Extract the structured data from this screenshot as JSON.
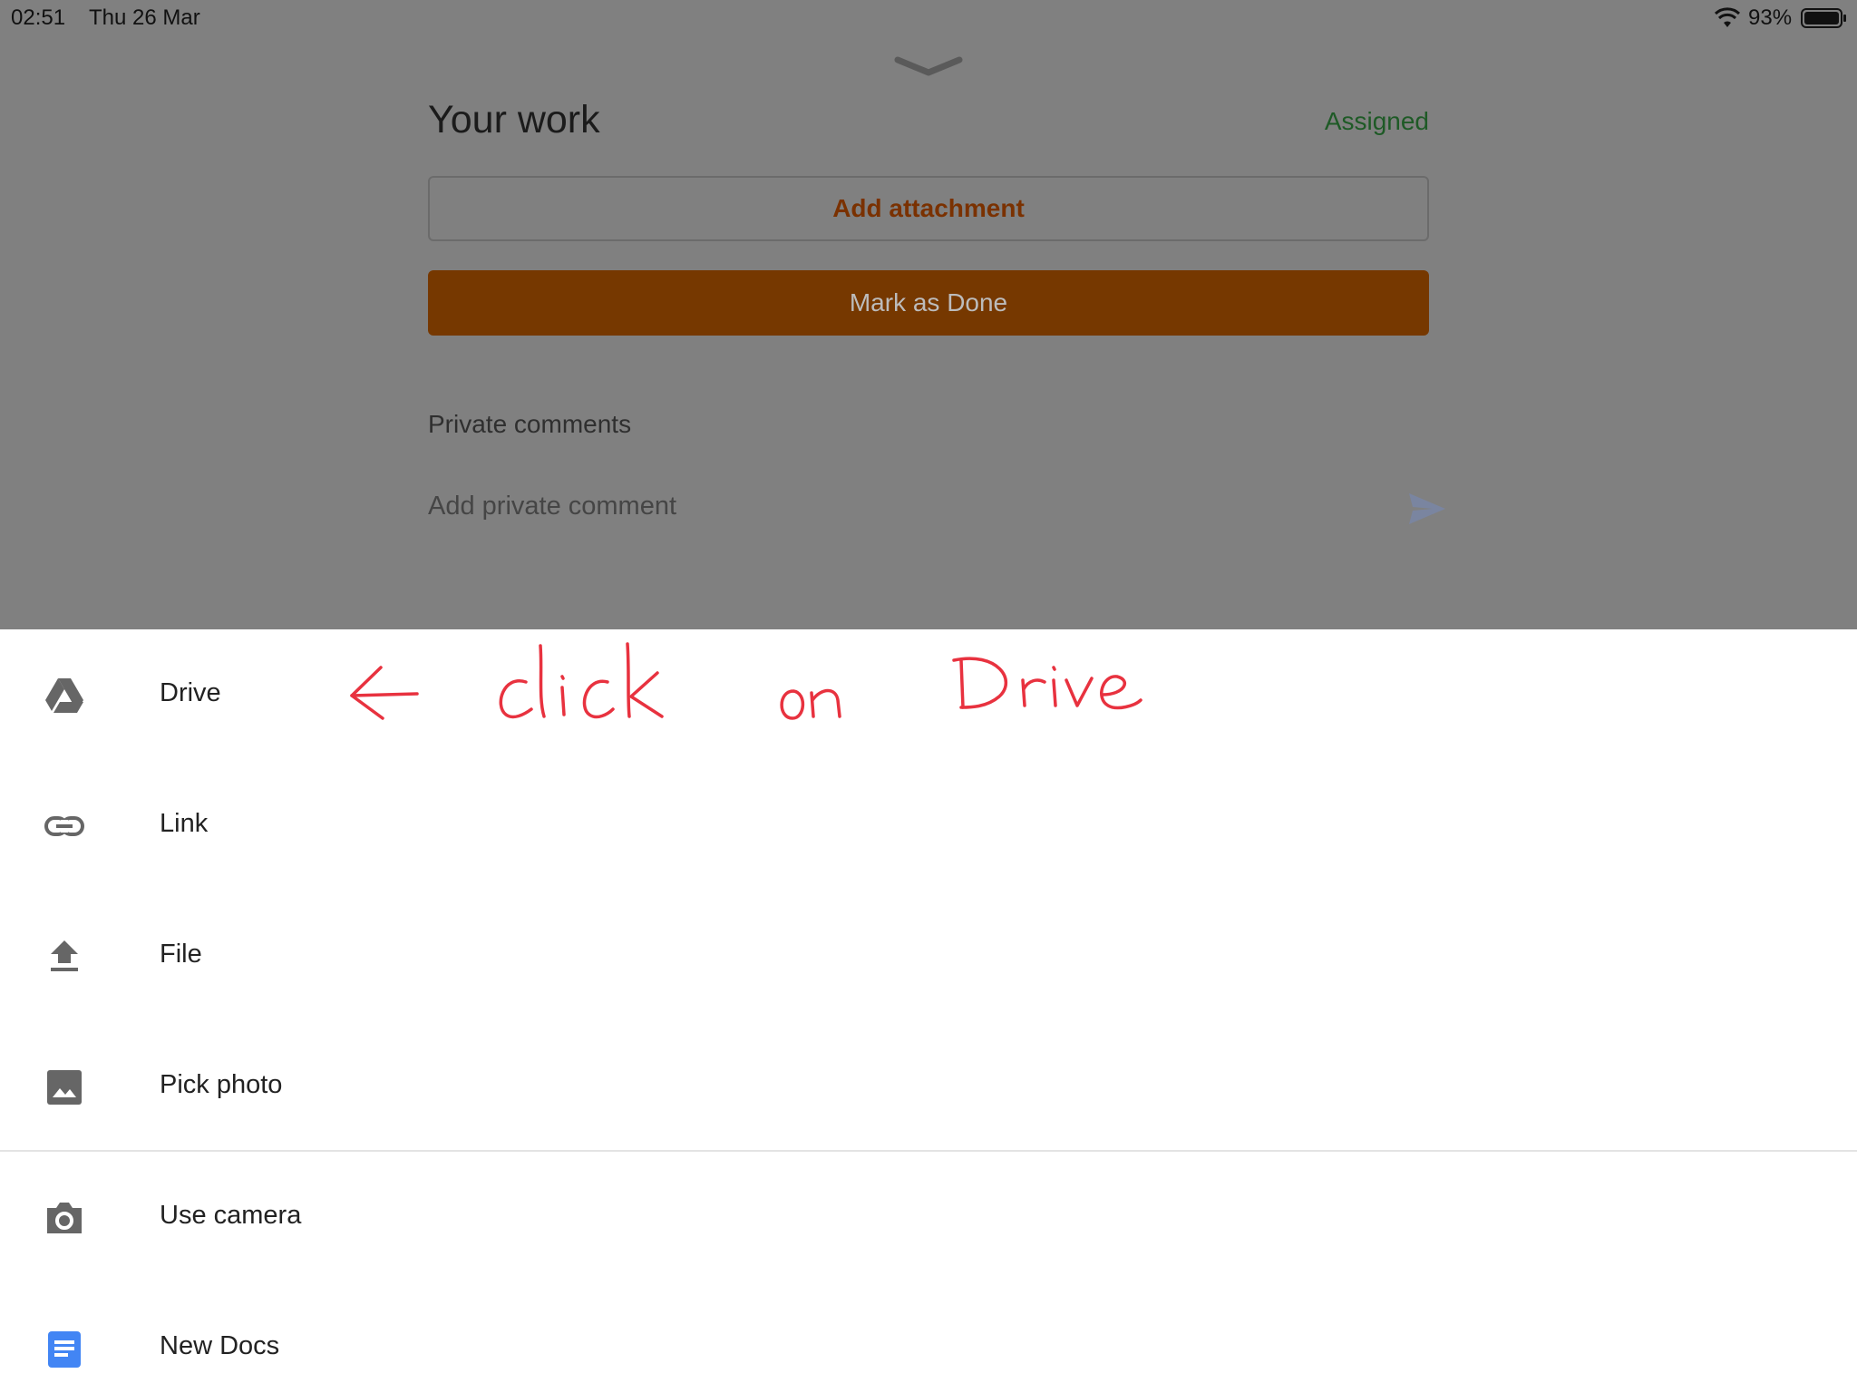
{
  "status_bar": {
    "time": "02:51",
    "date": "Thu 26 Mar",
    "battery_percent": "93%"
  },
  "header": {
    "title": "Your work",
    "status": "Assigned"
  },
  "buttons": {
    "add_attachment": "Add attachment",
    "mark_done": "Mark as Done"
  },
  "comments": {
    "title": "Private comments",
    "placeholder": "Add private comment"
  },
  "sheet": {
    "items": [
      {
        "label": "Drive",
        "icon": "drive-icon"
      },
      {
        "label": "Link",
        "icon": "link-icon"
      },
      {
        "label": "File",
        "icon": "upload-icon"
      },
      {
        "label": "Pick photo",
        "icon": "photo-icon"
      },
      {
        "label": "Use camera",
        "icon": "camera-icon"
      },
      {
        "label": "New Docs",
        "icon": "docs-icon"
      }
    ]
  },
  "annotation": {
    "text": "← click on Drive"
  },
  "colors": {
    "accent": "#763800",
    "accent_text": "#7a3100",
    "assigned": "#1e5a26",
    "docs_blue": "#4285f4"
  }
}
